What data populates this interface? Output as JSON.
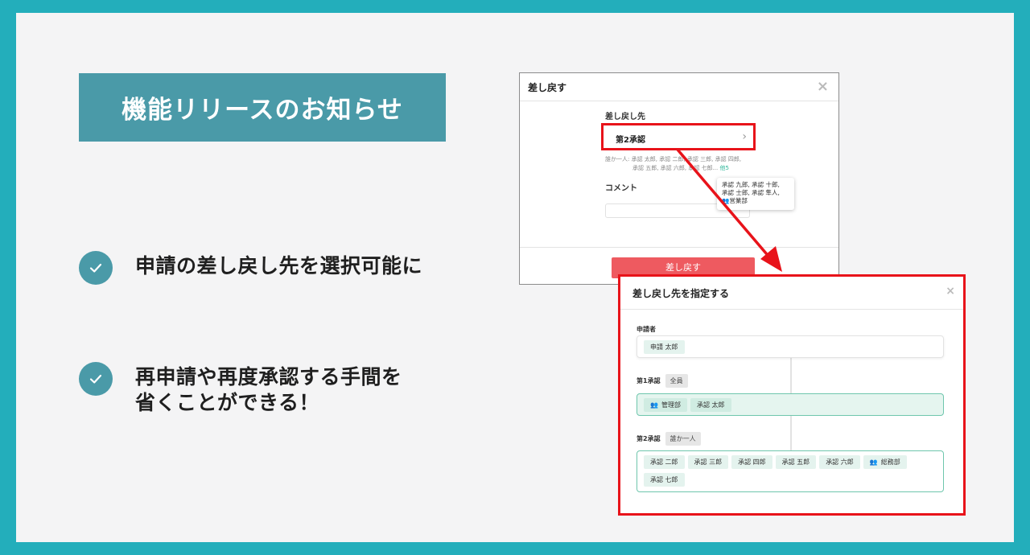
{
  "title": "機能リリースのお知らせ",
  "features": [
    {
      "text": "申請の差し戻し先を選択可能に"
    },
    {
      "text": "再申請や再度承認する手間を\n省くことができる！"
    }
  ],
  "modal1": {
    "title": "差し戻す",
    "close": "×",
    "field_label": "差し戻し先",
    "selected": "第2承認",
    "chevron": "›",
    "hint_line1": "誰か一人: 承認 太郎, 承認 二郎, 承認 三郎, 承認 四郎,",
    "hint_line2": "承認 五郎, 承認 六郎, 承認 七郎...",
    "hint_more": "他5",
    "tooltip_line1": "承認 九郎, 承認 十郎,",
    "tooltip_line2": "承認 士郎, 承認 隼人,",
    "tooltip_line3": "営業部",
    "comment_label": "コメント",
    "submit": "差し戻す"
  },
  "modal2": {
    "title": "差し戻し先を指定する",
    "close": "×",
    "applicant_label": "申請者",
    "applicant": "申請 太郎",
    "step1_label": "第1承認",
    "step1_badge": "全員",
    "step1_group": "管理部",
    "step1_person": "承認 太郎",
    "step2_label": "第2承認",
    "step2_badge": "誰か一人",
    "step2_people": [
      "承認 二郎",
      "承認 三郎",
      "承認 四郎",
      "承認 五郎",
      "承認 六郎"
    ],
    "step2_group": "総務部",
    "step2_person": "承認 七郎"
  },
  "colors": {
    "background": "#23aebb",
    "title_bg": "#4a9aa8",
    "highlight": "#e8131a",
    "submit": "#ee5a60",
    "chip": "#e4f3ee"
  }
}
